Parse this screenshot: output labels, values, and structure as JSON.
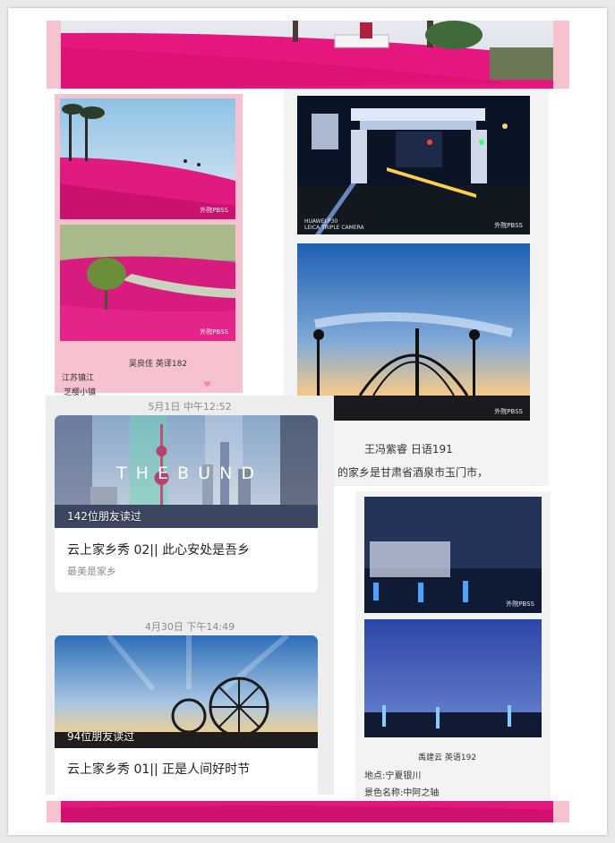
{
  "left_collage": {
    "name_line": "吴良佳  英译182",
    "place": "江苏镇江",
    "scene": "芝樱小镇",
    "watermark_1": "外院PBSS",
    "watermark_2": "外院PBSS"
  },
  "right_collage": {
    "camera_model": "HUAWEI P30",
    "camera_lens": "LEICA TRIPLE CAMERA",
    "watermark_1": "外院PBSS",
    "watermark_2": "外院PBSS",
    "name_line": "王冯紫睿  日语191",
    "text_line": "的家乡是甘肃省酒泉市玉门市，"
  },
  "feed": {
    "time_1": "5月1日 中午12:52",
    "card_1": {
      "banner_text": "T H E   B U N D",
      "readers": "142位朋友读过",
      "title": "云上家乡秀 02|| 此心安处是吾乡",
      "subtitle": "最美是家乡"
    },
    "time_2": "4月30日 下午14:49",
    "card_2": {
      "readers": "94位朋友读过",
      "title": "云上家乡秀 01|| 正是人间好时节"
    }
  },
  "bottom_right_collage": {
    "watermark_1": "外院PBSS",
    "name_line": "禹建云   英语192",
    "place": "地点:宁夏银川",
    "scene": "景色名称:中阿之轴"
  },
  "colors": {
    "pink_field": "#e5177e",
    "pink_border": "#f6c2cf",
    "night_blue": "#13274e",
    "feed_bg": "#ededed"
  }
}
